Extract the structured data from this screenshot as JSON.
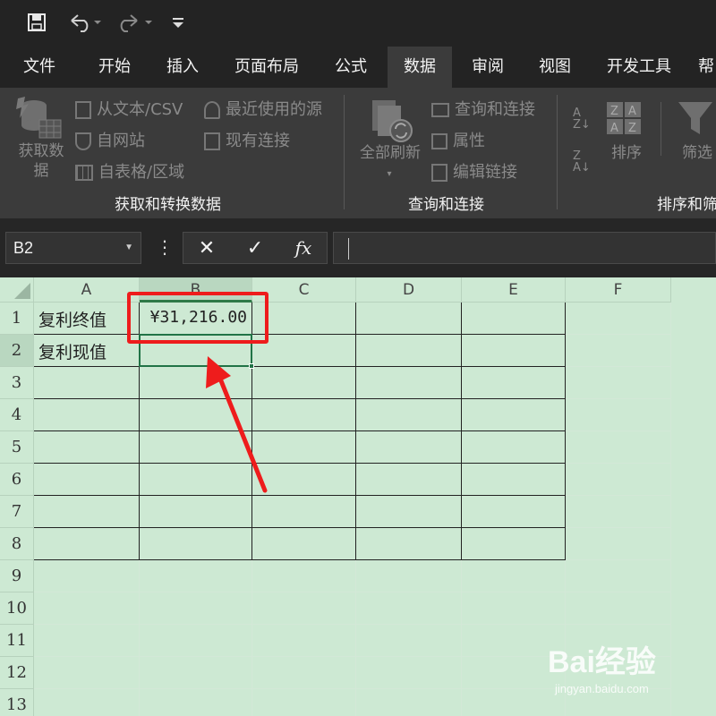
{
  "quick_access": {
    "save_icon": "save-icon",
    "undo_icon": "undo-icon",
    "redo_icon": "redo-icon",
    "customize_icon": "customize-qat-icon"
  },
  "tabs": [
    {
      "label": "文件"
    },
    {
      "label": "开始"
    },
    {
      "label": "插入"
    },
    {
      "label": "页面布局"
    },
    {
      "label": "公式"
    },
    {
      "label": "数据",
      "active": true
    },
    {
      "label": "审阅"
    },
    {
      "label": "视图"
    },
    {
      "label": "开发工具"
    },
    {
      "label": "帮"
    }
  ],
  "ribbon": {
    "get_data_label": "获取数\n据",
    "from_text_csv": "从文本/CSV",
    "from_web": "自网站",
    "from_table": "自表格/区域",
    "recent_sources": "最近使用的源",
    "existing_connections": "现有连接",
    "group_get_transform": "获取和转换数据",
    "refresh_all_label": "全部刷新",
    "queries_connections": "查询和连接",
    "properties": "属性",
    "edit_links": "编辑链接",
    "group_queries": "查询和连接",
    "sort_label": "排序",
    "filter_label": "筛选",
    "group_sort_filter": "排序和筛"
  },
  "formula_bar": {
    "name_box": "B2",
    "more_icon": "⋮",
    "cancel_icon": "✕",
    "enter_icon": "✓",
    "fx_label": "fx",
    "formula": ""
  },
  "sheet": {
    "columns": [
      "A",
      "B",
      "C",
      "D",
      "E",
      "F"
    ],
    "rows": [
      "1",
      "2",
      "3",
      "4",
      "5",
      "6",
      "7",
      "8",
      "9",
      "10",
      "11",
      "12",
      "13"
    ],
    "selected_column": "B",
    "selected_row": "2",
    "active_cell": "B2",
    "cells": {
      "A1": "复利终值",
      "B1": "¥31,216.00",
      "A2": "复利现值"
    }
  },
  "annotation": {
    "highlight_color": "#ee1c1c"
  },
  "watermark": {
    "brand": "Bai经验",
    "url": "jingyan.baidu.com"
  }
}
